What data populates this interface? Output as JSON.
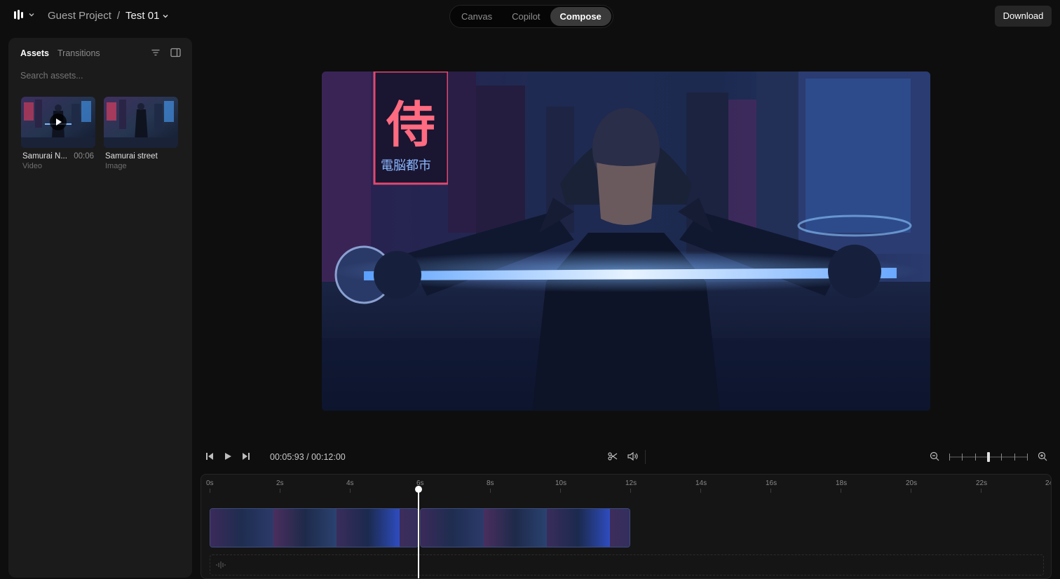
{
  "topbar": {
    "project": "Guest Project",
    "separator": "/",
    "file": "Test 01",
    "modes": [
      "Canvas",
      "Copilot",
      "Compose"
    ],
    "active_mode": "Compose",
    "download_label": "Download"
  },
  "sidebar": {
    "tabs": [
      "Assets",
      "Transitions"
    ],
    "active_tab": "Assets",
    "search_placeholder": "Search assets...",
    "assets": [
      {
        "name": "Samurai N...",
        "duration": "00:06",
        "type": "Video"
      },
      {
        "name": "Samurai street",
        "duration": "",
        "type": "Image"
      }
    ]
  },
  "player": {
    "timecode": "00:05:93 / 00:12:00",
    "zoom_level": 0.5
  },
  "timeline": {
    "ruler": [
      "0s",
      "2s",
      "4s",
      "6s",
      "8s",
      "10s",
      "12s",
      "14s",
      "16s",
      "18s",
      "20s",
      "22s",
      "24"
    ],
    "playhead_seconds": 5.93,
    "clips": [
      {
        "start": 0,
        "end": 6
      },
      {
        "start": 6,
        "end": 12
      }
    ]
  },
  "colors": {
    "accent_clip_border": "#3b4d7a",
    "background": "#0e0e0e",
    "panel": "#1b1b1b"
  },
  "icons": [
    "logo-icon",
    "chevron-down-icon",
    "filter-icon",
    "panel-toggle-icon",
    "skip-back-icon",
    "play-icon",
    "skip-forward-icon",
    "scissors-icon",
    "volume-icon",
    "zoom-out-icon",
    "zoom-in-icon",
    "audio-waveform-icon"
  ]
}
